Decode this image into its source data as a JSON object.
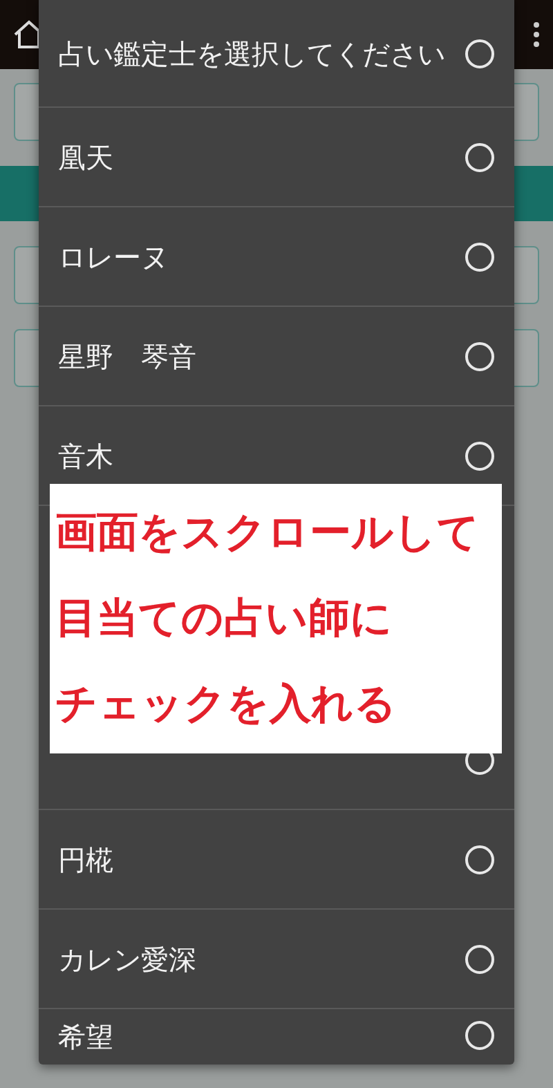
{
  "dialog": {
    "options": [
      {
        "label": "占い鑑定士を選択してください",
        "selected": false
      },
      {
        "label": "凰天",
        "selected": false
      },
      {
        "label": "ロレーヌ",
        "selected": false
      },
      {
        "label": "星野　琴音",
        "selected": false
      },
      {
        "label": "音木",
        "selected": false
      },
      {
        "selected": false
      },
      {
        "label": "円椛",
        "selected": false
      },
      {
        "label": "カレン愛深",
        "selected": false
      },
      {
        "label": "希望",
        "selected": false
      }
    ]
  },
  "annotation": {
    "lines": [
      "画面をスクロールして",
      "目当ての占い師に",
      "チェックを入れる"
    ]
  }
}
